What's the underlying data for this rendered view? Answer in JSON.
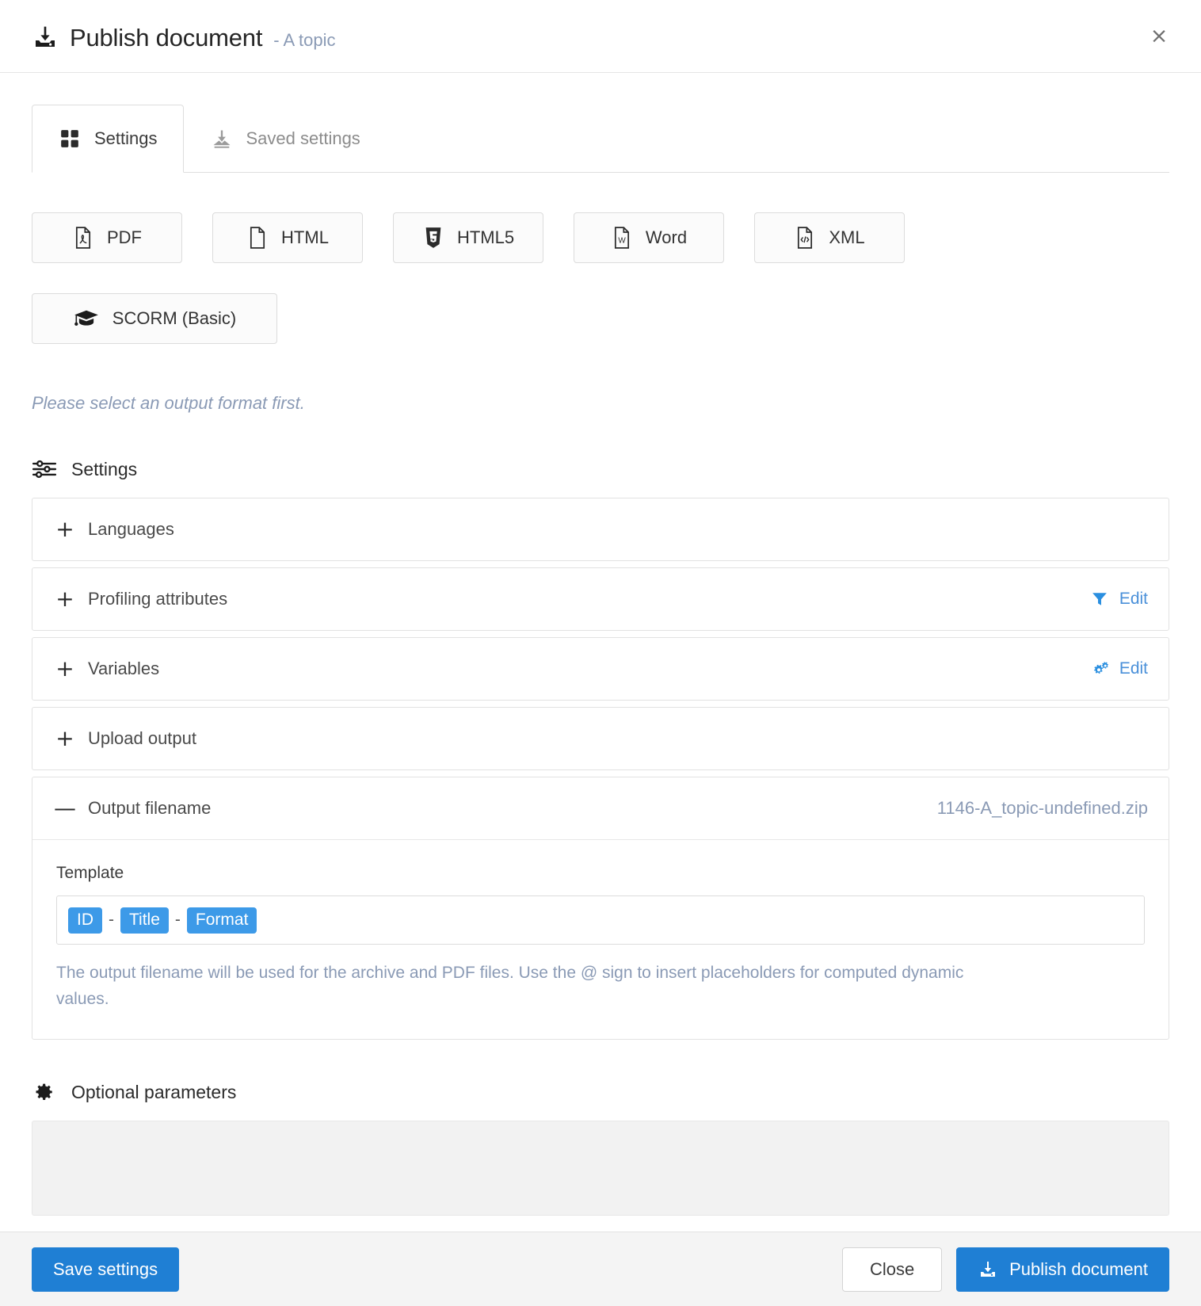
{
  "header": {
    "icon": "publish-download-icon",
    "title": "Publish document",
    "subtitle": "- A topic",
    "close_label": "×"
  },
  "tabs": [
    {
      "label": "Settings",
      "icon": "grid-squares-icon",
      "active": true
    },
    {
      "label": "Saved settings",
      "icon": "download-tray-icon",
      "active": false
    }
  ],
  "formats": [
    {
      "label": "PDF",
      "icon": "file-pdf-icon"
    },
    {
      "label": "HTML",
      "icon": "file-blank-icon"
    },
    {
      "label": "HTML5",
      "icon": "html5-shield-icon"
    },
    {
      "label": "Word",
      "icon": "file-word-icon"
    },
    {
      "label": "XML",
      "icon": "file-code-icon"
    },
    {
      "label": "SCORM (Basic)",
      "icon": "graduation-cap-icon"
    }
  ],
  "notice": "Please select an output format first.",
  "settings_section": {
    "icon": "sliders-icon",
    "title": "Settings",
    "items": [
      {
        "sign": "+",
        "label": "Languages",
        "expanded": false,
        "action": null,
        "value": null
      },
      {
        "sign": "+",
        "label": "Profiling attributes",
        "expanded": false,
        "action": {
          "label": "Edit",
          "icon": "filter-funnel-icon"
        },
        "value": null
      },
      {
        "sign": "+",
        "label": "Variables",
        "expanded": false,
        "action": {
          "label": "Edit",
          "icon": "cogs-icon"
        },
        "value": null
      },
      {
        "sign": "+",
        "label": "Upload output",
        "expanded": false,
        "action": null,
        "value": null
      },
      {
        "sign": "—",
        "label": "Output filename",
        "expanded": true,
        "action": null,
        "value": "1146-A_topic-undefined.zip"
      }
    ]
  },
  "output_filename": {
    "template_label": "Template",
    "tokens": [
      "ID",
      "Title",
      "Format"
    ],
    "separator": "-",
    "help": "The output filename will be used for the archive and PDF files. Use the @ sign to insert placeholders for computed dynamic values."
  },
  "optional_parameters": {
    "icon": "gear-icon",
    "title": "Optional parameters"
  },
  "footer": {
    "save_label": "Save settings",
    "close_label": "Close",
    "publish_label": "Publish document",
    "publish_icon": "publish-download-icon"
  },
  "colors": {
    "accent_blue": "#1f7fd4",
    "token_blue": "#3d9ae8",
    "link_blue": "#4a90d9",
    "muted_blue": "#8a9ab5",
    "footer_bg": "#f4f4f4",
    "panel_bg": "#f2f2f2"
  }
}
